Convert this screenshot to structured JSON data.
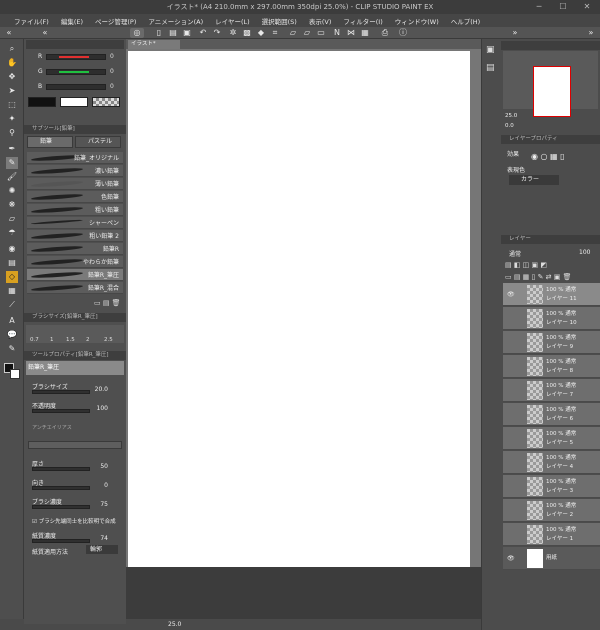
{
  "window": {
    "title": "イラスト* (A4 210.0mm x 297.00mm 350dpi 25.0%) - CLIP STUDIO PAINT EX",
    "minimize": "─",
    "maximize": "☐",
    "close": "✕"
  },
  "menu": [
    "ファイル(F)",
    "編集(E)",
    "ページ管理(P)",
    "アニメーション(A)",
    "レイヤー(L)",
    "選択範囲(S)",
    "表示(V)",
    "フィルター(I)",
    "ウィンドウ(W)",
    "ヘルプ(H)"
  ],
  "canvas_tab": "イラスト*",
  "color_panel": {
    "r_label": "R",
    "g_label": "G",
    "b_label": "B",
    "r_value": "0",
    "g_value": "0",
    "b_value": "0",
    "accent_r": "#e03030",
    "accent_g": "#20c040"
  },
  "subtool_panel": {
    "header": "サブツール[鉛筆]",
    "tab_pencil": "鉛筆",
    "tab_pastel": "パステル",
    "brushes": [
      "鉛筆_オリジナル",
      "濃い鉛筆",
      "薄い鉛筆",
      "色鉛筆",
      "粗い鉛筆",
      "シャーペン",
      "粗い鉛筆 2",
      "鉛筆R",
      "やわらか鉛筆",
      "鉛筆R_筆圧",
      "鉛筆R_混合"
    ]
  },
  "brushsize_panel": {
    "header": "ブラシサイズ[鉛筆R_筆圧]",
    "sizes": [
      "0.7",
      "1",
      "1.5",
      "2",
      "2.5"
    ]
  },
  "toolprop_panel": {
    "header": "ツールプロパティ[鉛筆R_筆圧]",
    "brush_name": "鉛筆R_筆圧",
    "brush_size_label": "ブラシサイズ",
    "brush_size_value": "20.0",
    "opacity_label": "不透明度",
    "opacity_value": "100",
    "antialias_label": "アンチエイリアス",
    "thickness_label": "厚さ",
    "thickness_value": "50",
    "direction_label": "向き",
    "direction_value": "0",
    "density_label": "ブラシ濃度",
    "density_value": "75",
    "combine_label": "ブラシ先端同士を比較明で合成",
    "paper_density_label": "紙質濃度",
    "paper_density_value": "74",
    "paper_method_label": "紙質適用方法",
    "paper_method_value": "輪郭"
  },
  "status_zoom": "25.0",
  "layer_property_panel": {
    "header": "レイヤープロパティ",
    "effect_label": "効果",
    "expression_label": "表現色",
    "expression_value": "カラー"
  },
  "layer_panel": {
    "header": "レイヤー",
    "blend_mode": "通常",
    "opacity": "100",
    "layers": [
      {
        "mode": "100 % 通常",
        "name": "レイヤー 11"
      },
      {
        "mode": "100 % 通常",
        "name": "レイヤー 10"
      },
      {
        "mode": "100 % 通常",
        "name": "レイヤー 9"
      },
      {
        "mode": "100 % 通常",
        "name": "レイヤー 8"
      },
      {
        "mode": "100 % 通常",
        "name": "レイヤー 7"
      },
      {
        "mode": "100 % 通常",
        "name": "レイヤー 6"
      },
      {
        "mode": "100 % 通常",
        "name": "レイヤー 5"
      },
      {
        "mode": "100 % 通常",
        "name": "レイヤー 4"
      },
      {
        "mode": "100 % 通常",
        "name": "レイヤー 3"
      },
      {
        "mode": "100 % 通常",
        "name": "レイヤー 2"
      },
      {
        "mode": "100 % 通常",
        "name": "レイヤー 1"
      }
    ],
    "paper_layer": "用紙"
  },
  "navigator": {
    "zoom": "25.0",
    "rotate": "0.0"
  }
}
